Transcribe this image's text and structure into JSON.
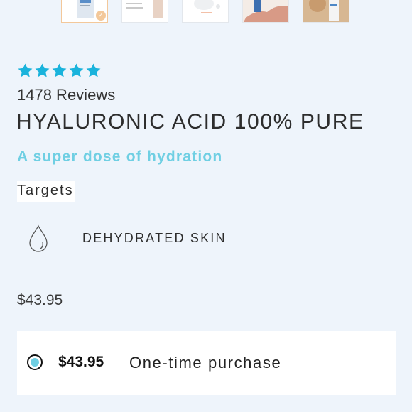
{
  "gallery": {
    "thumbnails": [
      "product-bottle-thumb",
      "product-card-thumb",
      "texture-thumb",
      "applying-thumb",
      "model-thumb"
    ],
    "selected_index": 0
  },
  "rating": {
    "stars": 5,
    "star_color": "#1ab3dc",
    "reviews_text": "1478 Reviews"
  },
  "product": {
    "title": "HYALURONIC ACID 100% PURE",
    "subtitle": "A super dose of hydration",
    "accent_color": "#6fcfe3"
  },
  "targets": {
    "heading": "Targets",
    "items": [
      {
        "icon": "water-drop-icon",
        "label": "DEHYDRATED SKIN"
      }
    ]
  },
  "price": "$43.95",
  "purchase_options": [
    {
      "price": "$43.95",
      "label": "One-time purchase",
      "selected": true
    }
  ]
}
